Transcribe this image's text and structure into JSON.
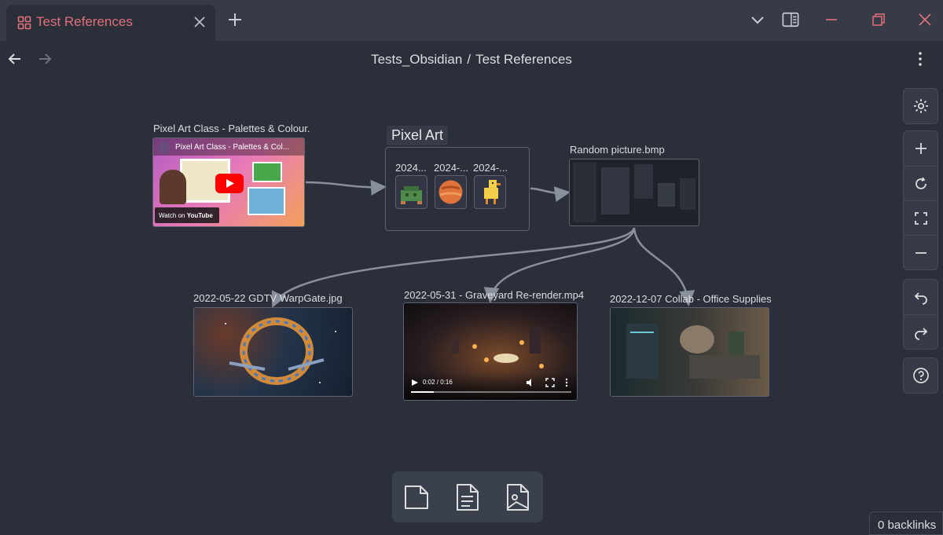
{
  "tab": {
    "title": "Test References",
    "icon": "canvas-icon"
  },
  "breadcrumb": {
    "folder": "Tests_Obsidian",
    "separator": "/",
    "file": "Test References"
  },
  "nodes": {
    "video": {
      "label": "Pixel Art Class - Palettes & Colour...",
      "overlay_title": "Pixel Art Class - Palettes & Col...",
      "watch_on": "Watch on",
      "brand": "YouTube"
    },
    "group": {
      "label": "Pixel Art",
      "items": [
        {
          "label": "2024..."
        },
        {
          "label": "2024-..."
        },
        {
          "label": "2024-..."
        }
      ]
    },
    "random": {
      "label": "Random picture.bmp"
    },
    "warpgate": {
      "label": "2022-05-22 GDTV WarpGate.jpg"
    },
    "graveyard": {
      "label": "2022-05-31 - Graveyard Re-render.mp4",
      "time": "0:02 / 0:16"
    },
    "office": {
      "label": "2022-12-07 Collab - Office Supplies..."
    }
  },
  "backlinks": "0 backlinks",
  "colors": {
    "accent": "#e0707a",
    "background": "#2b2f3a",
    "panel": "#363b47"
  }
}
